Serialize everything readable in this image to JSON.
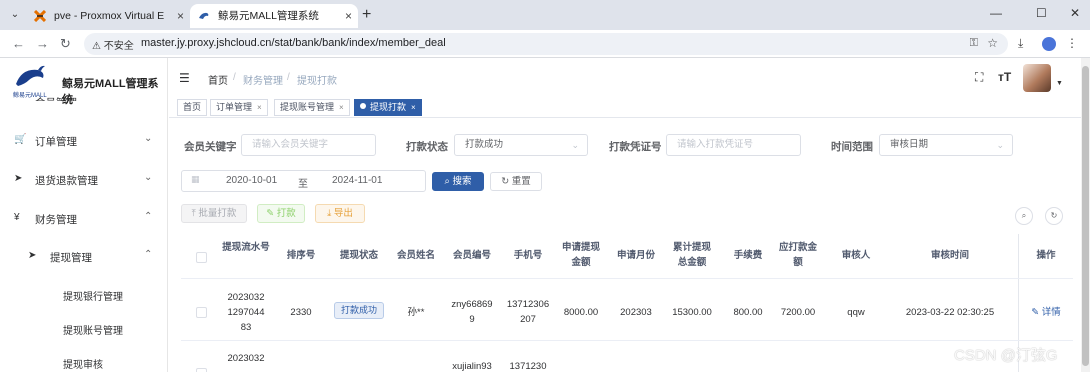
{
  "browser": {
    "tabs": [
      {
        "title": "pve - Proxmox Virtual Environ",
        "active": false
      },
      {
        "title": "鲸易元MALL管理系统",
        "active": true
      }
    ],
    "new_tab": "+",
    "address": {
      "security": "不安全",
      "url": "master.jy.proxy.jshcloud.cn/stat/bank/bank/index/member_deal"
    }
  },
  "sidebar": {
    "app_title": "鲸易元MALL管理系统",
    "logo_text": "鲸易元MALL",
    "cut_item": "会员管理",
    "menus": [
      {
        "label": "订单管理",
        "icon": "cart-icon"
      },
      {
        "label": "退货退款管理",
        "icon": "send-icon"
      },
      {
        "label": "财务管理",
        "icon": "yen-icon"
      }
    ],
    "submenu": {
      "label": "提现管理",
      "icon": "send-icon"
    },
    "leaves": [
      "提现银行管理",
      "提现账号管理",
      "提现审核"
    ]
  },
  "header": {
    "breadcrumb": [
      "首页",
      "财务管理",
      "提现打款"
    ],
    "separator": "/"
  },
  "tags": [
    {
      "label": "首页",
      "closable": false,
      "active": false
    },
    {
      "label": "订单管理",
      "closable": true,
      "active": false
    },
    {
      "label": "提现账号管理",
      "closable": true,
      "active": false
    },
    {
      "label": "提现打款",
      "closable": true,
      "active": true
    }
  ],
  "filters": {
    "member_keyword": {
      "label": "会员关键字",
      "placeholder": "请输入会员关键字"
    },
    "payout_status": {
      "label": "打款状态",
      "value": "打款成功"
    },
    "voucher_no": {
      "label": "打款凭证号",
      "placeholder": "请输入打款凭证号"
    },
    "time_range": {
      "label": "时间范围",
      "value": "审核日期"
    },
    "date_start": "2020-10-01",
    "date_to": "至",
    "date_end": "2024-11-01",
    "search_label": "搜索",
    "reset_label": "重置"
  },
  "actions": {
    "batch_payout": "批量打款",
    "payout": "打款",
    "export": "导出"
  },
  "table": {
    "headers": [
      "提现流水号",
      "排序号",
      "提现状态",
      "会员姓名",
      "会员编号",
      "手机号",
      "申请提现金额",
      "申请月份",
      "累计提现总金额",
      "手续费",
      "应打款金额",
      "审核人",
      "审核时间",
      "操作"
    ],
    "rows": [
      {
        "serial": "2023032129704483",
        "sort_no": "2330",
        "status": "打款成功",
        "member_name": "孙**",
        "member_no": "zny668699",
        "phone": "13712306207",
        "apply_amount": "8000.00",
        "apply_month": "202303",
        "total_amount": "15300.00",
        "fee": "800.00",
        "payable": "7200.00",
        "auditor": "qqw",
        "audit_time": "2023-03-22 02:30:25",
        "op": "详情"
      },
      {
        "serial": "2023032",
        "sort_no": "",
        "status": "",
        "member_name": "",
        "member_no": "xujialin93",
        "phone": "1371230",
        "apply_amount": "",
        "apply_month": "",
        "total_amount": "",
        "fee": "",
        "payable": "",
        "auditor": "",
        "audit_time": "",
        "op": ""
      }
    ]
  },
  "watermark": "CSDN @汀弦G",
  "colors": {
    "primary": "#2f5ea8",
    "success": "#67c23a",
    "warning": "#e6a23c"
  }
}
